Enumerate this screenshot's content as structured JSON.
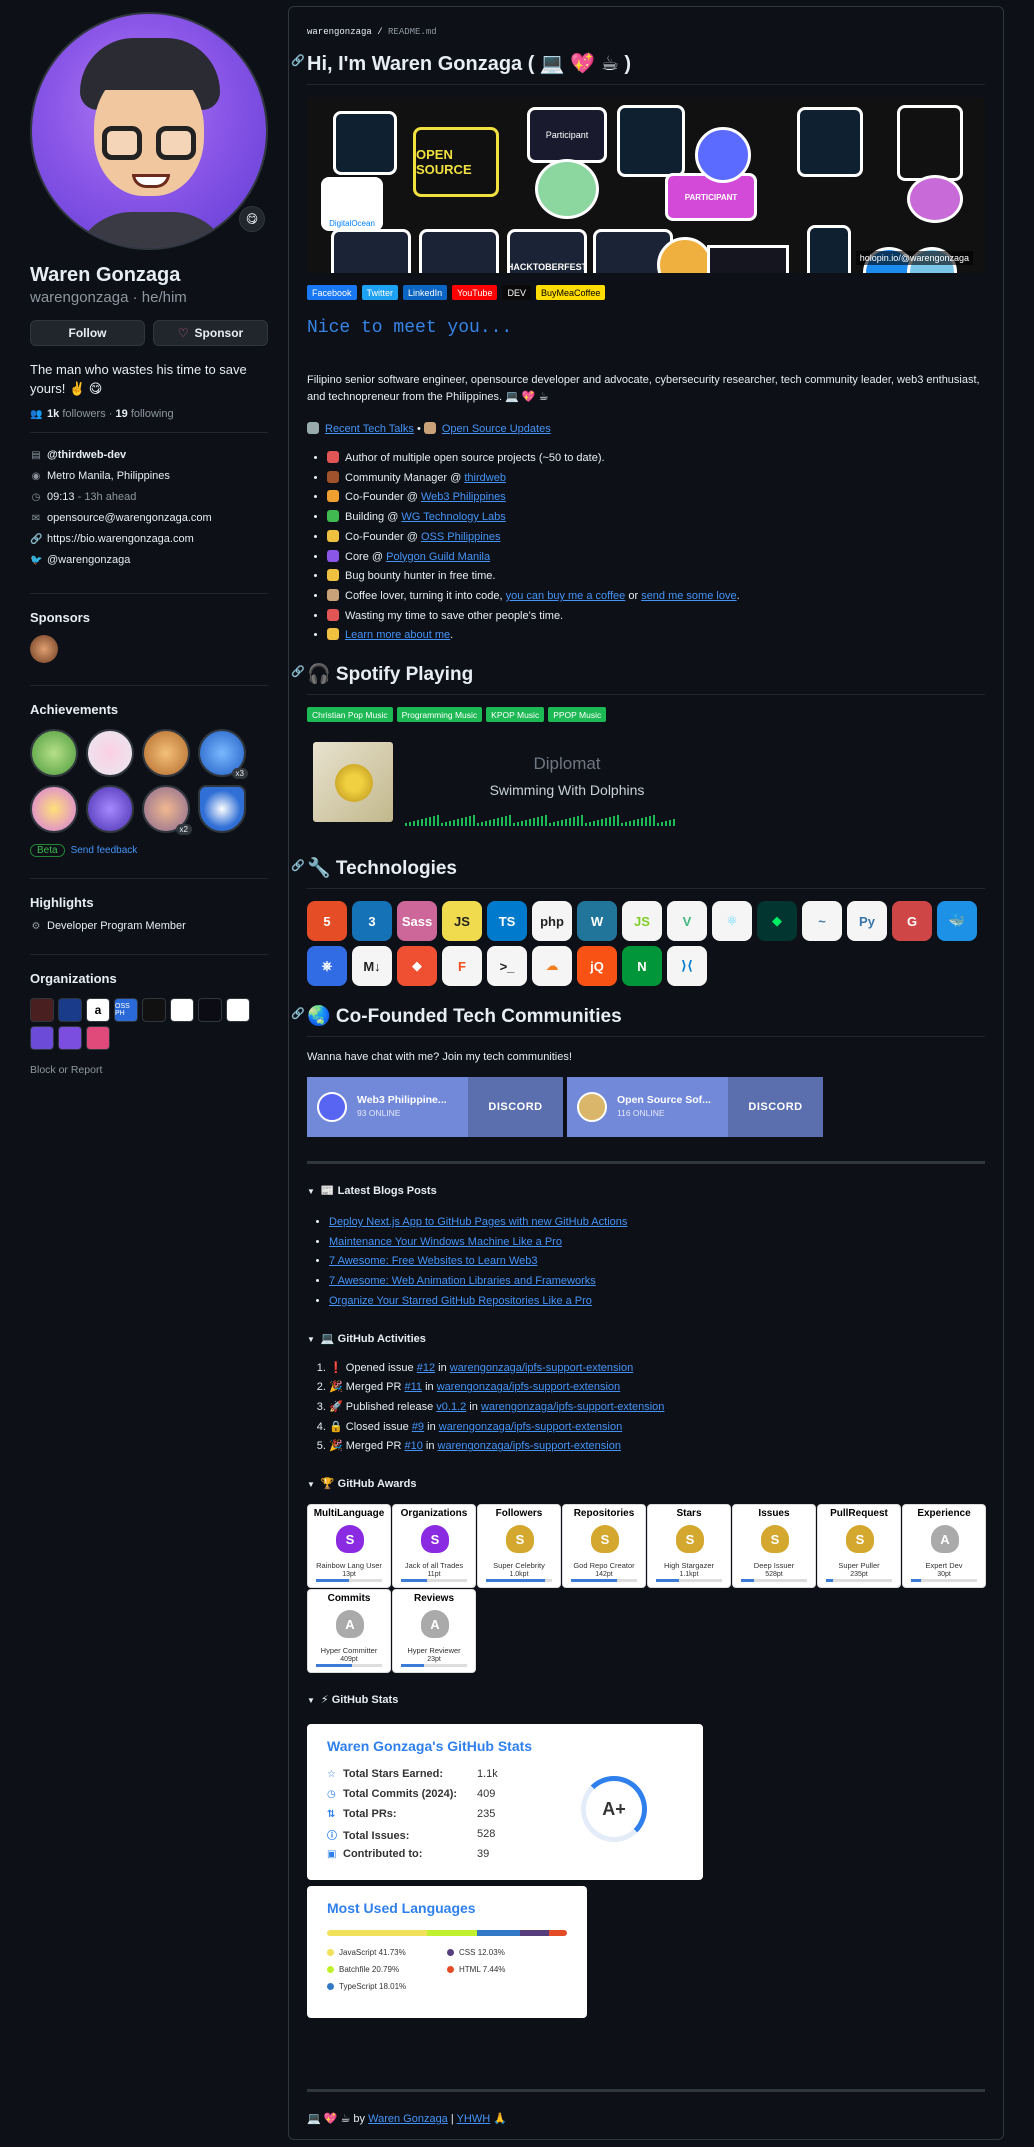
{
  "profile": {
    "name": "Waren Gonzaga",
    "login": "warengonzaga",
    "pronouns": "he/him",
    "follow_label": "Follow",
    "sponsor_label": "Sponsor",
    "bio": "The man who wastes his time to save yours! ✌️ 😋",
    "followers": "1k",
    "followers_label": "followers",
    "following": "19",
    "following_label": "following",
    "company": "@thirdweb-dev",
    "location": "Metro Manila, Philippines",
    "local_time": "09:13",
    "time_note": "- 13h ahead",
    "email": "opensource@warengonzaga.com",
    "website": "https://bio.warengonzaga.com",
    "twitter": "@warengonzaga"
  },
  "sidebar": {
    "sponsors_heading": "Sponsors",
    "achievements_heading": "Achievements",
    "achievement_counts": [
      "x3",
      "x2"
    ],
    "beta_label": "Beta",
    "feedback_label": "Send feedback",
    "highlights_heading": "Highlights",
    "highlight_item": "Developer Program Member",
    "orgs_heading": "Organizations",
    "org_labels": [
      "",
      "",
      "a",
      "OSS PH",
      "",
      "",
      "",
      ""
    ],
    "block_label": "Block or Report"
  },
  "readme": {
    "breadcrumb_user": "warengonzaga",
    "breadcrumb_file": "README.md",
    "title": "Hi, I'm Waren Gonzaga ( 💻 💖 ☕ )",
    "banner_credit": "holopin.io/@warengonzaga",
    "banner_stickers": [
      "OPEN SOURCE",
      "Participant",
      "HACKTOBERFEST",
      "PARTICIPANT",
      "DigitalOcean"
    ],
    "shields": [
      {
        "label": "Facebook",
        "color": "#1877f2"
      },
      {
        "label": "Twitter",
        "color": "#1da1f2"
      },
      {
        "label": "LinkedIn",
        "color": "#0a66c2"
      },
      {
        "label": "YouTube",
        "color": "#ff0000"
      },
      {
        "label": "DEV",
        "color": "#0a0a0a"
      },
      {
        "label": "BuyMeaCoffee",
        "color": "#ffdd00"
      }
    ],
    "nice": "Nice to meet you...",
    "intro": "Filipino senior software engineer, opensource developer and advocate, cybersecurity researcher, tech community leader, web3 enthusiast, and technopreneur from the Philippines. 💻 💖 ☕",
    "talks_link": "Recent Tech Talks",
    "talks_sep": "•",
    "updates_link": "Open Source Updates",
    "facts": [
      {
        "pre": "Author of multiple open source projects (~50 to date).",
        "link": "",
        "post": "",
        "color": "#e25555"
      },
      {
        "pre": "Community Manager @ ",
        "link": "thirdweb",
        "post": "",
        "color": "#a0522d"
      },
      {
        "pre": "Co-Founder @ ",
        "link": "Web3 Philippines",
        "post": "",
        "color": "#f0a030"
      },
      {
        "pre": "Building @ ",
        "link": "WG Technology Labs",
        "post": "",
        "color": "#3fb950"
      },
      {
        "pre": "Co-Founder @ ",
        "link": "OSS Philippines",
        "post": "",
        "color": "#f0c040"
      },
      {
        "pre": "Core @ ",
        "link": "Polygon Guild Manila",
        "post": "",
        "color": "#8a56e8"
      },
      {
        "pre": "Bug bounty hunter in free time.",
        "link": "",
        "post": "",
        "color": "#f0c040"
      },
      {
        "pre": "Coffee lover, turning it into code, ",
        "link": "you can buy me a coffee",
        "post": " or ",
        "link2": "send me some love",
        "post2": ".",
        "color": "#c9a27a"
      },
      {
        "pre": "Wasting my time to save other people's time.",
        "link": "",
        "post": "",
        "color": "#e25555"
      },
      {
        "pre": "",
        "link": "Learn more about me",
        "post": ".",
        "color": "#f0c040"
      }
    ],
    "spotify_heading": "🎧 Spotify Playing",
    "playlists": [
      "Christian Pop Music",
      "Programming Music",
      "KPOP Music",
      "PPOP Music"
    ],
    "spotify_artist": "Diplomat",
    "spotify_song": "Swimming With Dolphins",
    "tech_heading": "🔧 Technologies",
    "tech": [
      {
        "name": "html5-icon",
        "label": "5",
        "bg": "#e44d26",
        "fg": "#fff"
      },
      {
        "name": "css3-icon",
        "label": "3",
        "bg": "#1572b6",
        "fg": "#fff"
      },
      {
        "name": "sass-icon",
        "label": "Sass",
        "bg": "#cd6799",
        "fg": "#fff"
      },
      {
        "name": "javascript-icon",
        "label": "JS",
        "bg": "#f0db4f",
        "fg": "#222"
      },
      {
        "name": "typescript-icon",
        "label": "TS",
        "bg": "#007acc",
        "fg": "#fff"
      },
      {
        "name": "php-icon",
        "label": "php",
        "bg": "#f5f5f5",
        "fg": "#222"
      },
      {
        "name": "wordpress-icon",
        "label": "W",
        "bg": "#21759b",
        "fg": "#fff"
      },
      {
        "name": "nodejs-icon",
        "label": "JS",
        "bg": "#f5f5f5",
        "fg": "#83cd29"
      },
      {
        "name": "vue-icon",
        "label": "V",
        "bg": "#f5f5f5",
        "fg": "#41b883"
      },
      {
        "name": "react-icon",
        "label": "⚛",
        "bg": "#f5f5f5",
        "fg": "#61dafb"
      },
      {
        "name": "mongodb-icon",
        "label": "◆",
        "bg": "#023430",
        "fg": "#00ed64"
      },
      {
        "name": "mysql-icon",
        "label": "~",
        "bg": "#f5f5f5",
        "fg": "#4479a1"
      },
      {
        "name": "python-icon",
        "label": "Py",
        "bg": "#f5f5f5",
        "fg": "#3776ab"
      },
      {
        "name": "gulp-icon",
        "label": "G",
        "bg": "#cf4647",
        "fg": "#fff"
      },
      {
        "name": "docker-icon",
        "label": "🐳",
        "bg": "#1d91e6",
        "fg": "#fff"
      },
      {
        "name": "kubernetes-icon",
        "label": "⎈",
        "bg": "#326ce5",
        "fg": "#fff"
      },
      {
        "name": "markdown-icon",
        "label": "M↓",
        "bg": "#f5f5f5",
        "fg": "#222"
      },
      {
        "name": "git-icon",
        "label": "◆",
        "bg": "#f05032",
        "fg": "#fff"
      },
      {
        "name": "figma-icon",
        "label": "F",
        "bg": "#f5f5f5",
        "fg": "#f24e1e"
      },
      {
        "name": "bash-icon",
        "label": ">_",
        "bg": "#f5f5f5",
        "fg": "#222"
      },
      {
        "name": "cloudflare-icon",
        "label": "☁",
        "bg": "#f5f5f5",
        "fg": "#f38020"
      },
      {
        "name": "jquery-icon",
        "label": "jQ",
        "bg": "#f85214",
        "fg": "#fff"
      },
      {
        "name": "nginx-icon",
        "label": "N",
        "bg": "#009639",
        "fg": "#fff"
      },
      {
        "name": "vscode-icon",
        "label": "⟩⟨",
        "bg": "#f5f5f5",
        "fg": "#007acc"
      }
    ],
    "communities_heading": "🌏 Co-Founded Tech Communities",
    "chat_text": "Wanna have chat with me? Join my tech communities!",
    "discord": [
      {
        "name": "Web3 Philippine...",
        "count": "93 ONLINE",
        "logo": "DISCORD"
      },
      {
        "name": "Open Source Sof...",
        "count": "116 ONLINE",
        "logo": "DISCORD"
      }
    ],
    "blogs_summary": "📰 Latest Blogs Posts",
    "blogs": [
      "Deploy Next.js App to GitHub Pages with new GitHub Actions",
      "Maintenance Your Windows Machine Like a Pro",
      "7 Awesome: Free Websites to Learn Web3",
      "7 Awesome: Web Animation Libraries and Frameworks",
      "Organize Your Starred GitHub Repositories Like a Pro"
    ],
    "activities_summary": "💻 GitHub Activities",
    "activities": [
      {
        "emoji": "❗",
        "action": "Opened issue ",
        "ref": "#12",
        "in": " in ",
        "repo": "warengonzaga/ipfs-support-extension"
      },
      {
        "emoji": "🎉",
        "action": "Merged PR ",
        "ref": "#11",
        "in": " in ",
        "repo": "warengonzaga/ipfs-support-extension"
      },
      {
        "emoji": "🚀",
        "action": "Published release ",
        "ref": "v0.1.2",
        "in": " in ",
        "repo": "warengonzaga/ipfs-support-extension"
      },
      {
        "emoji": "🔒",
        "action": "Closed issue ",
        "ref": "#9",
        "in": " in ",
        "repo": "warengonzaga/ipfs-support-extension"
      },
      {
        "emoji": "🎉",
        "action": "Merged PR ",
        "ref": "#10",
        "in": " in ",
        "repo": "warengonzaga/ipfs-support-extension"
      }
    ],
    "awards_summary": "🏆 GitHub Awards",
    "awards": [
      {
        "title": "MultiLanguage",
        "rank": "S",
        "tier": "Rainbow Lang User",
        "points": "13pt",
        "color": "#8a2be2",
        "progress": 0.5
      },
      {
        "title": "Organizations",
        "rank": "S",
        "tier": "Jack of all Trades",
        "points": "11pt",
        "color": "#8a2be2",
        "progress": 0.4
      },
      {
        "title": "Followers",
        "rank": "S",
        "tier": "Super Celebrity",
        "points": "1.0kpt",
        "color": "#d4a82e",
        "progress": 0.9
      },
      {
        "title": "Repositories",
        "rank": "S",
        "tier": "God Repo Creator",
        "points": "142pt",
        "color": "#d4a82e",
        "progress": 0.7
      },
      {
        "title": "Stars",
        "rank": "S",
        "tier": "High Stargazer",
        "points": "1.1kpt",
        "color": "#d4a82e",
        "progress": 0.35
      },
      {
        "title": "Issues",
        "rank": "S",
        "tier": "Deep Issuer",
        "points": "528pt",
        "color": "#d4a82e",
        "progress": 0.2
      },
      {
        "title": "PullRequest",
        "rank": "S",
        "tier": "Super Puller",
        "points": "235pt",
        "color": "#d4a82e",
        "progress": 0.1
      },
      {
        "title": "Experience",
        "rank": "A",
        "tier": "Expert Dev",
        "points": "30pt",
        "color": "#aaaaaa",
        "progress": 0.15
      },
      {
        "title": "Commits",
        "rank": "A",
        "tier": "Hyper Committer",
        "points": "409pt",
        "color": "#aaaaaa",
        "progress": 0.55
      },
      {
        "title": "Reviews",
        "rank": "A",
        "tier": "Hyper Reviewer",
        "points": "23pt",
        "color": "#aaaaaa",
        "progress": 0.35
      }
    ],
    "stats_summary": "⚡ GitHub Stats",
    "stats_title": "Waren Gonzaga's GitHub Stats",
    "stats": [
      {
        "icon": "☆",
        "label": "Total Stars Earned:",
        "value": "1.1k"
      },
      {
        "icon": "◷",
        "label": "Total Commits (2024):",
        "value": "409"
      },
      {
        "icon": "⇅",
        "label": "Total PRs:",
        "value": "235"
      },
      {
        "icon": "ⓘ",
        "label": "Total Issues:",
        "value": "528"
      },
      {
        "icon": "▣",
        "label": "Contributed to:",
        "value": "39"
      }
    ],
    "grade": "A+",
    "langs_title": "Most Used Languages",
    "langs": [
      {
        "name": "JavaScript",
        "pct": "41.73%",
        "value": 41.73,
        "color": "#f1e05a"
      },
      {
        "name": "CSS",
        "pct": "12.03%",
        "value": 12.03,
        "color": "#563d7c"
      },
      {
        "name": "Batchfile",
        "pct": "20.79%",
        "value": 20.79,
        "color": "#c1f12e"
      },
      {
        "name": "HTML",
        "pct": "7.44%",
        "value": 7.44,
        "color": "#e34c26"
      },
      {
        "name": "TypeScript",
        "pct": "18.01%",
        "value": 18.01,
        "color": "#3178c6"
      }
    ],
    "footer_pre": "💻 💖 ☕ by ",
    "footer_link1": "Waren Gonzaga",
    "footer_sep": " | ",
    "footer_link2": "YHWH",
    "footer_post": " 🙏"
  }
}
